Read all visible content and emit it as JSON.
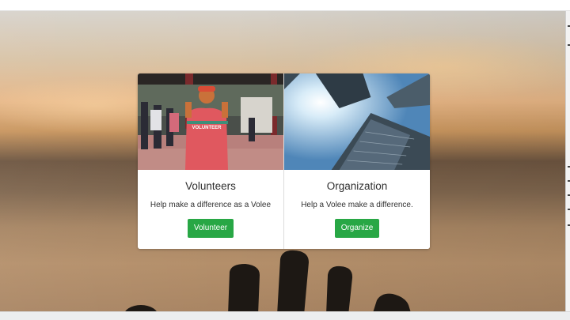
{
  "cards": [
    {
      "title": "Volunteers",
      "text": "Help make a difference as a Volee",
      "button": "Volunteer",
      "image": "volunteer-photo",
      "shirt_text": "VOLUNTEER"
    },
    {
      "title": "Organization",
      "text": "Help a Volee make a difference.",
      "button": "Organize",
      "image": "skyscrapers-photo"
    }
  ],
  "colors": {
    "button": "#28a745",
    "shirt": "#e0585f"
  }
}
